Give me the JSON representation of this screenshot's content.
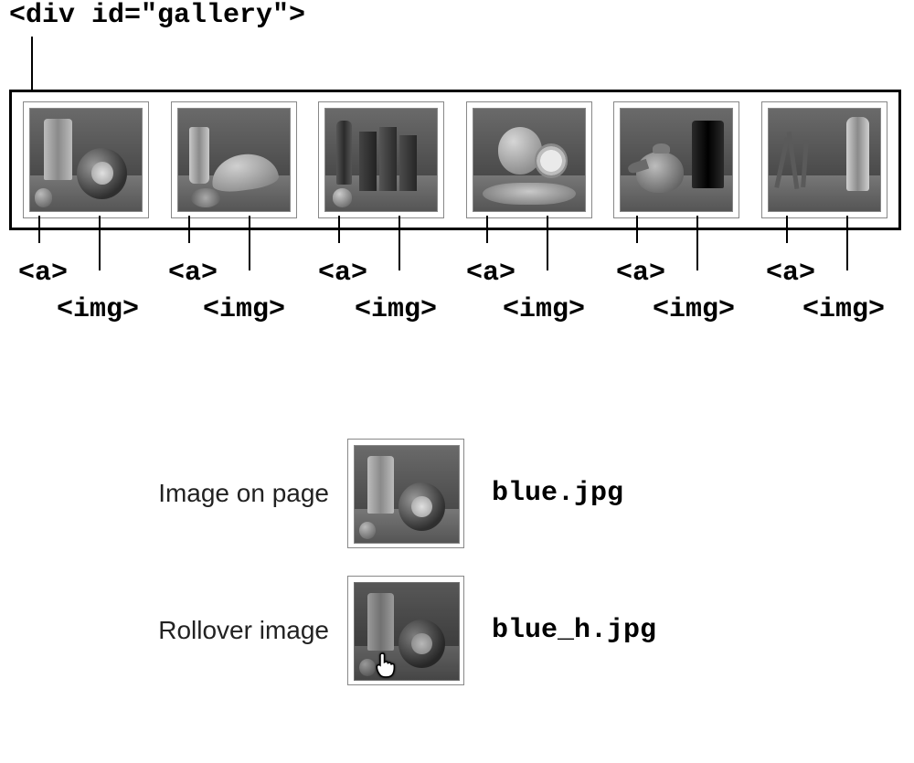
{
  "top_code_label": "<div id=\"gallery\">",
  "tag_a_label": "<a>",
  "tag_img_label": "<img>",
  "explain": {
    "row1_label": "Image on page",
    "row1_file": "blue.jpg",
    "row2_label": "Rollover image",
    "row2_file": "blue_h.jpg"
  },
  "thumbs": [
    {
      "variant": 1,
      "alt": "glass and alarm clock still life"
    },
    {
      "variant": 2,
      "alt": "jar and bananas still life"
    },
    {
      "variant": 3,
      "alt": "bottle and books still life"
    },
    {
      "variant": 4,
      "alt": "oranges on a plate still life"
    },
    {
      "variant": 5,
      "alt": "teapot and dark bottle still life"
    },
    {
      "variant": 6,
      "alt": "tall bottle and dried twigs still life"
    }
  ]
}
